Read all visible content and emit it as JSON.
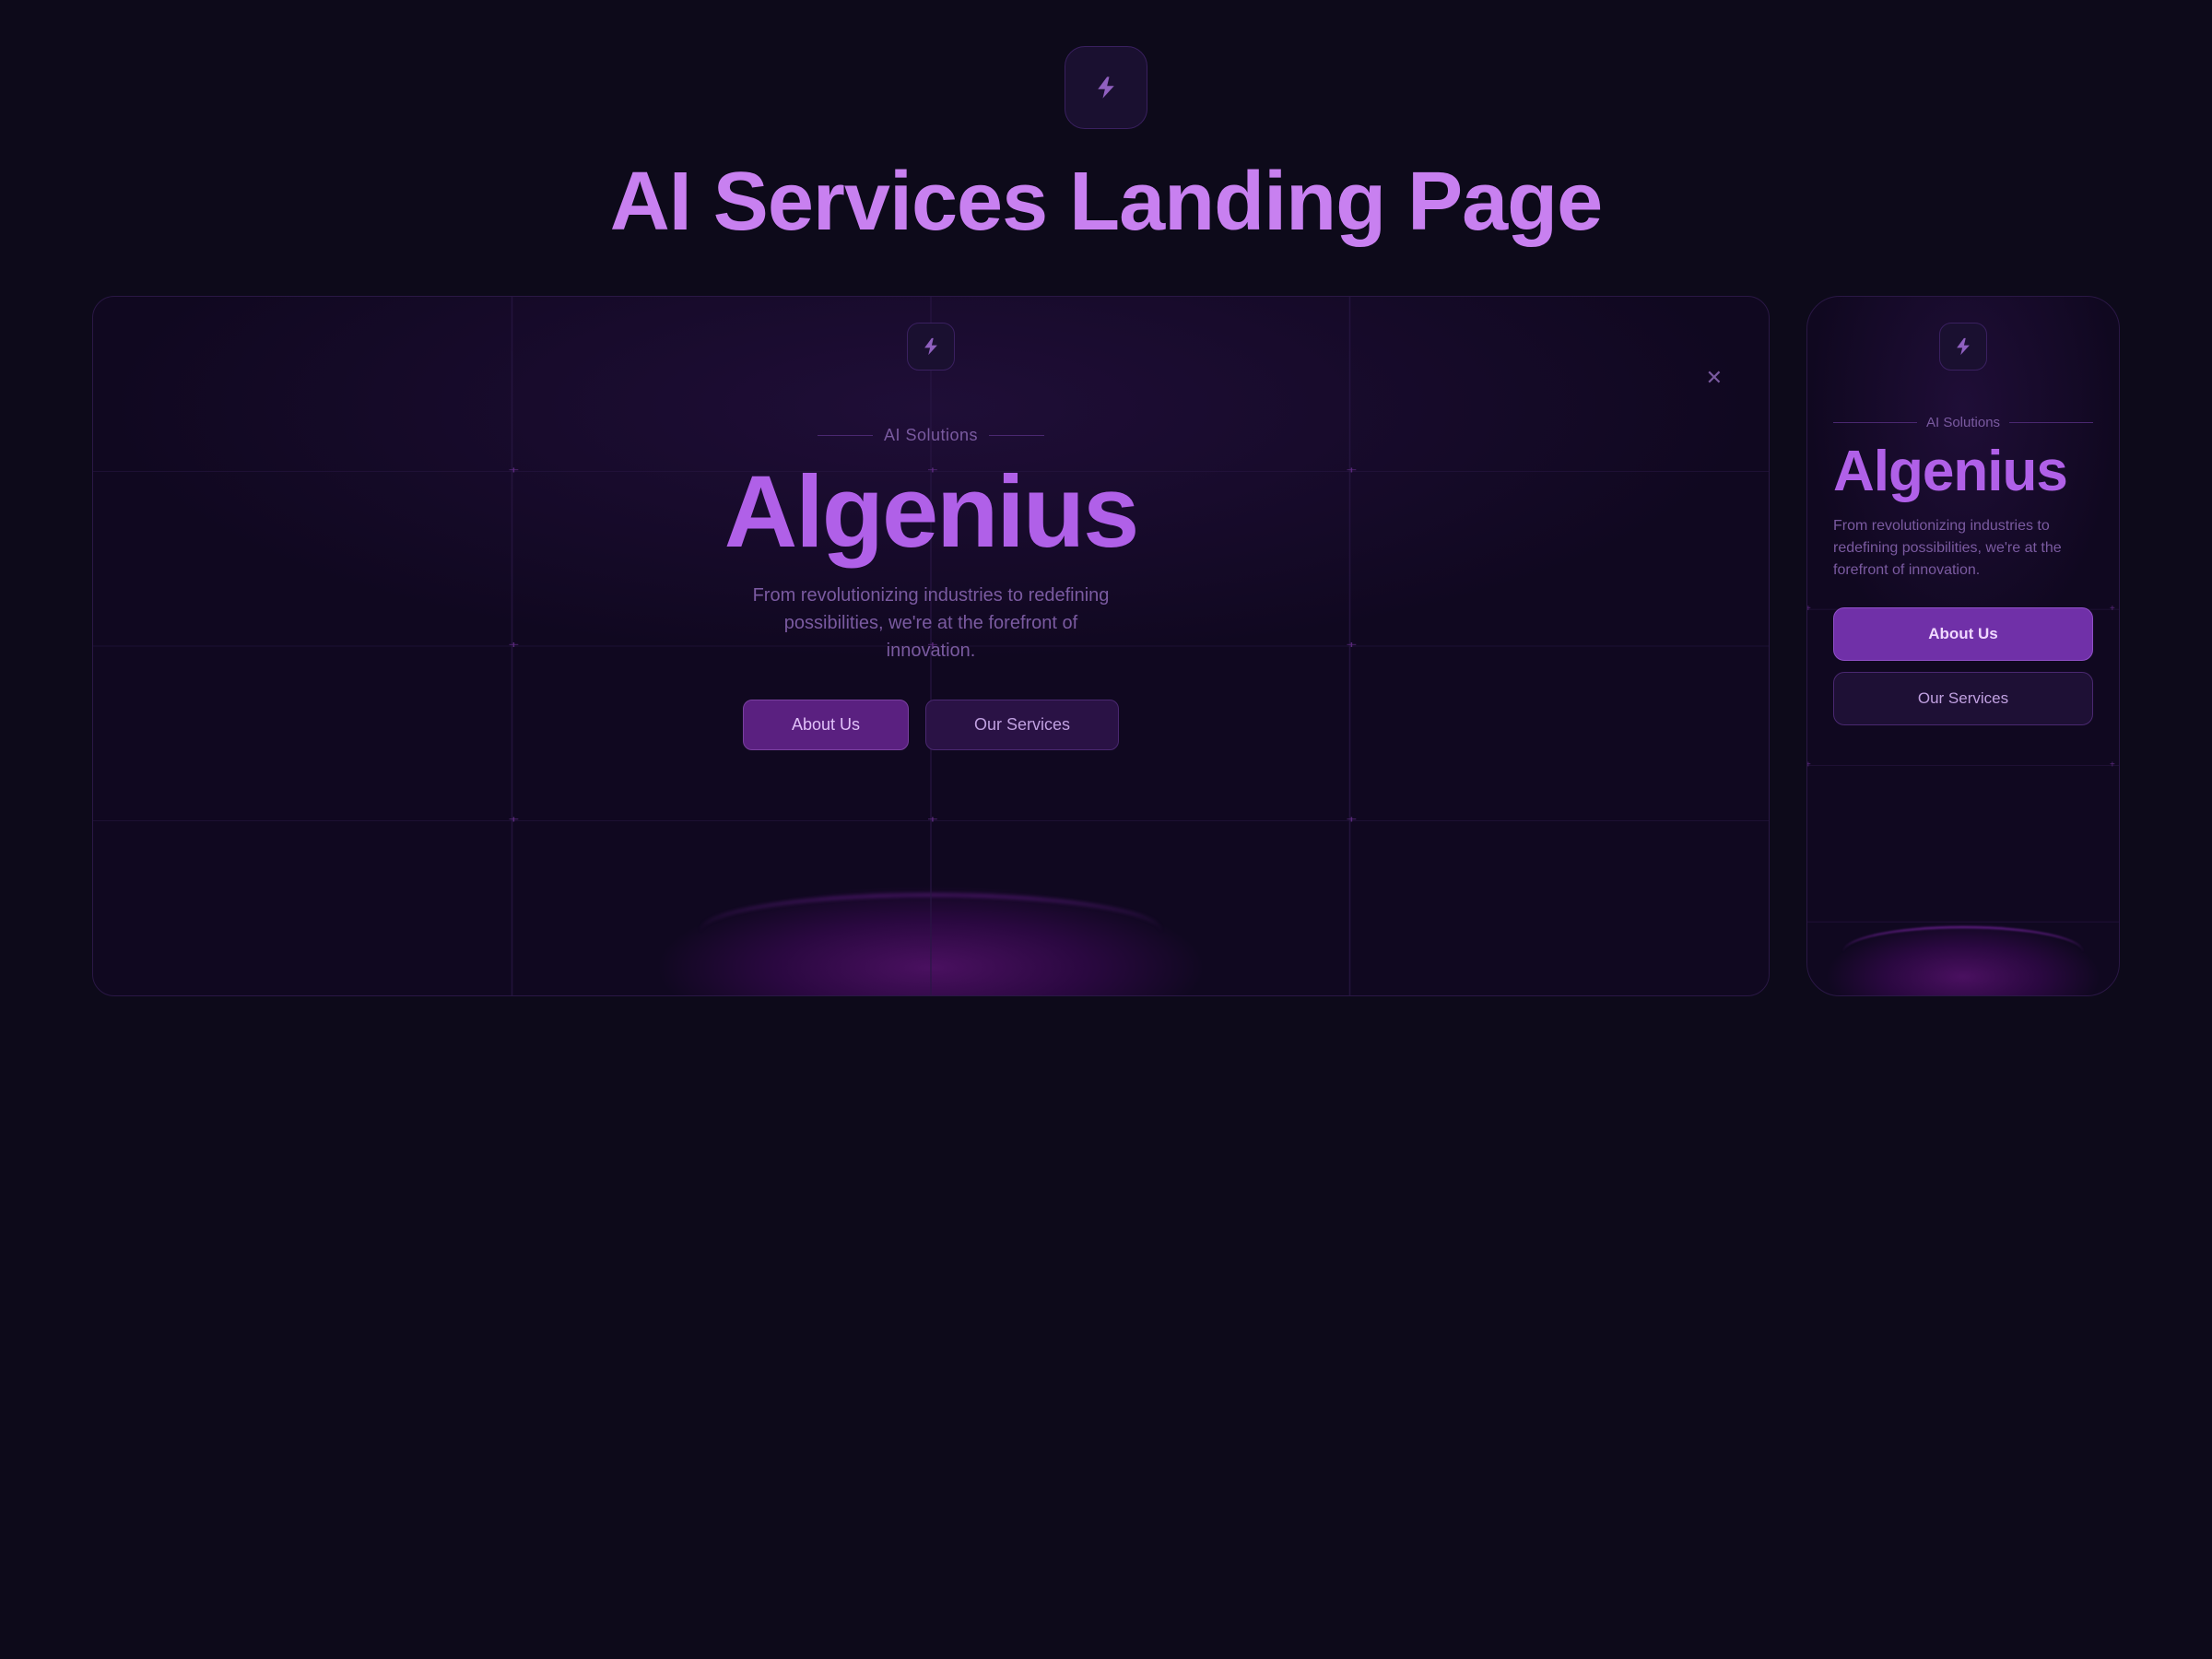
{
  "page": {
    "title": "AI Services Landing Page",
    "bg_color": "#0d0a1a"
  },
  "logo": {
    "icon_label": "lightning-bolt"
  },
  "desktop_mockup": {
    "ai_solutions_label": "AI Solutions",
    "brand_title": "Algenius",
    "subtitle": "From revolutionizing industries to redefining possibilities, we're at the forefront of innovation.",
    "btn_about": "About Us",
    "btn_services": "Our Services"
  },
  "mobile_mockup": {
    "ai_solutions_label": "AI Solutions",
    "brand_title": "Algenius",
    "subtitle": "From revolutionizing industries to redefining possibilities, we're at the forefront of innovation.",
    "btn_about": "About Us",
    "btn_services": "Our Services"
  }
}
